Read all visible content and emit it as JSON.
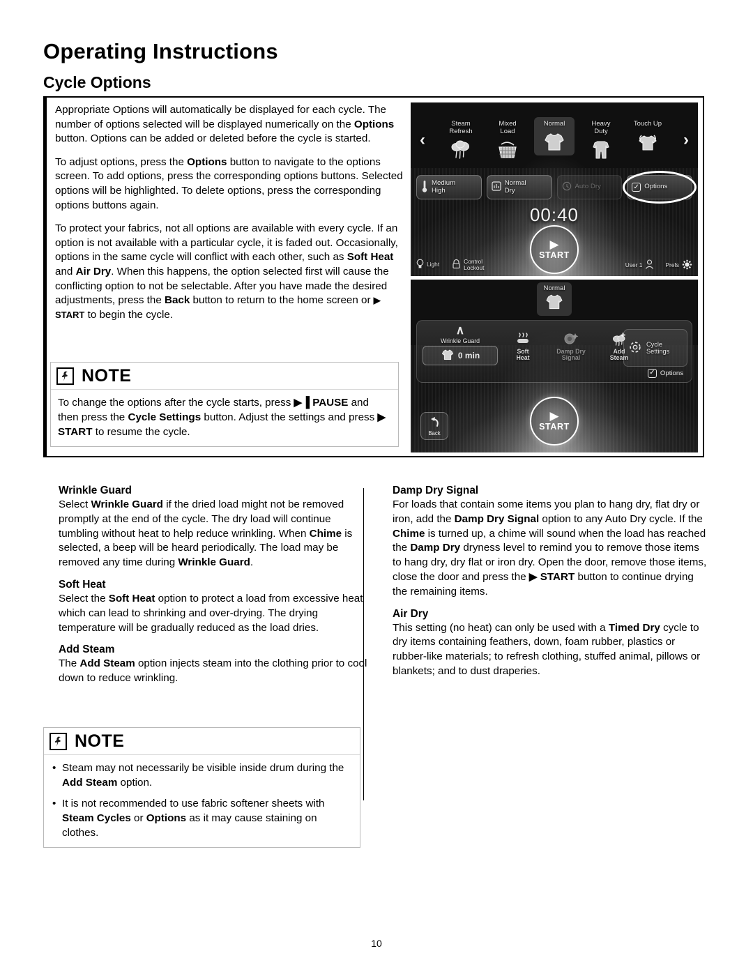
{
  "headings": {
    "h1": "Operating Instructions",
    "h2": "Cycle Options"
  },
  "intro": {
    "p1_a": "Appropriate Options will automatically be displayed for each cycle. The number of options selected will be displayed numerically on the ",
    "p1_b": "Options",
    "p1_c": " button. Options can be added or deleted before the cycle is started.",
    "p2_a": "To adjust options, press the ",
    "p2_b": "Options",
    "p2_c": " button to navigate to the options screen. To add options, press the corresponding options buttons. Selected options will be highlighted. To delete options, press the corresponding options buttons again.",
    "p3_a": "To protect your fabrics, not all options are available with every cycle. If an option is not available with a particular cycle, it is faded out. Occasionally, options in the same cycle will conflict with each other, such as ",
    "p3_b": "Soft Heat",
    "p3_c": " and ",
    "p3_d": "Air Dry",
    "p3_e": ". When this happens, the option selected first will cause the conflicting option to not be selectable. After you have made the desired adjustments, press the ",
    "p3_f": "Back",
    "p3_g": " button to return to the home screen or ",
    "p3_h": "▶ START",
    "p3_i": " to begin the cycle."
  },
  "note1": {
    "title": "NOTE",
    "icon": "pushpin-icon",
    "a": "To change the options after the cycle starts, press ",
    "b": "▶▐ PAUSE",
    "c": " and then press the ",
    "d": "Cycle Settings",
    "e": " button. Adjust the settings and press ",
    "f": "▶ START",
    "g": " to resume the cycle."
  },
  "panel1": {
    "prev_arrow": "‹",
    "next_arrow": "›",
    "cycles": [
      {
        "label": "Steam\nRefresh",
        "icon": "steam-cloud-icon",
        "selected": false
      },
      {
        "label": "Mixed\nLoad",
        "icon": "laundry-basket-icon",
        "selected": false
      },
      {
        "label": "Normal",
        "icon": "tshirt-icon",
        "selected": true
      },
      {
        "label": "Heavy\nDuty",
        "icon": "coveralls-icon",
        "selected": false
      },
      {
        "label": "Touch Up",
        "icon": "tshirt-refresh-icon",
        "selected": false
      }
    ],
    "options": [
      {
        "label": "Medium\nHigh",
        "icon": "thermometer-icon",
        "faded": false,
        "highlighted": false
      },
      {
        "label": "Normal\nDry",
        "icon": "dryness-icon",
        "faded": false,
        "highlighted": false
      },
      {
        "label": "Auto Dry",
        "icon": "clock-icon",
        "faded": true,
        "highlighted": false
      },
      {
        "label": "Options",
        "icon": "checkbox-icon",
        "faded": false,
        "highlighted": true
      }
    ],
    "timer": "00:40",
    "start_label": "START",
    "start_triangle": "▶",
    "bottom_left": [
      {
        "label": "Light",
        "icon": "bulb-icon"
      },
      {
        "label": "Control\nLockout",
        "icon": "lock-icon"
      }
    ],
    "bottom_right": [
      {
        "label": "User 1",
        "icon": "user-icon"
      },
      {
        "label": "Prefs",
        "icon": "gear-icon"
      }
    ]
  },
  "panel2": {
    "selected_cycle": "Normal",
    "selected_cycle_icon": "tshirt-icon",
    "wrinkle_guard": {
      "chevron": "∧",
      "label": "Wrinkle Guard",
      "value": "0 min",
      "icon": "tshirt-icon"
    },
    "options": [
      {
        "label": "Soft\nHeat",
        "icon": "soft-heat-icon",
        "faded": false
      },
      {
        "label": "Damp Dry\nSignal",
        "icon": "damp-dry-signal-icon",
        "faded": true
      },
      {
        "label": "Add\nSteam",
        "icon": "add-steam-icon",
        "faded": false
      }
    ],
    "cycle_settings": {
      "label": "Cycle\nSettings",
      "icon": "cycle-settings-icon"
    },
    "options_checkbox": {
      "label": "Options",
      "check": "✓"
    },
    "back_button": {
      "label": "Back",
      "icon": "back-arrow-icon"
    },
    "start_label": "START",
    "start_triangle": "▶"
  },
  "sections_left": [
    {
      "heading": "Wrinkle Guard",
      "parts": [
        {
          "t": "Select ",
          "b": false
        },
        {
          "t": "Wrinkle Guard",
          "b": true
        },
        {
          "t": " if the dried load might not be removed promptly at the end of the cycle. The dry load will continue tumbling without heat to help reduce wrinkling. When ",
          "b": false
        },
        {
          "t": "Chime",
          "b": true
        },
        {
          "t": " is selected, a beep will be heard periodically. The load may be removed any time during ",
          "b": false
        },
        {
          "t": "Wrinkle Guard",
          "b": true
        },
        {
          "t": ".",
          "b": false
        }
      ]
    },
    {
      "heading": "Soft Heat",
      "parts": [
        {
          "t": "Select the ",
          "b": false
        },
        {
          "t": "Soft Heat",
          "b": true
        },
        {
          "t": " option to protect a load from excessive heat which can lead to shrinking and over-drying. The drying temperature will be gradually reduced as the load dries.",
          "b": false
        }
      ]
    },
    {
      "heading": "Add Steam",
      "parts": [
        {
          "t": "The ",
          "b": false
        },
        {
          "t": "Add Steam",
          "b": true
        },
        {
          "t": " option injects steam into the clothing prior to cool down to reduce wrinkling.",
          "b": false
        }
      ]
    }
  ],
  "sections_right": [
    {
      "heading": "Damp Dry Signal",
      "parts": [
        {
          "t": "For loads that contain some items you plan to hang dry, flat dry or iron, add the ",
          "b": false
        },
        {
          "t": "Damp Dry Signal",
          "b": true
        },
        {
          "t": " option to any Auto Dry cycle. If the ",
          "b": false
        },
        {
          "t": "Chime",
          "b": true
        },
        {
          "t": " is turned up, a chime will sound when the load has reached the ",
          "b": false
        },
        {
          "t": "Damp Dry",
          "b": true
        },
        {
          "t": " dryness level to remind you to remove those items to hang dry, dry flat or iron dry. Open the door, remove those items, close the door and press the ",
          "b": false
        },
        {
          "t": "▶ START",
          "b": true
        },
        {
          "t": " button to continue drying the remaining items.",
          "b": false
        }
      ]
    },
    {
      "heading": "Air Dry",
      "parts": [
        {
          "t": "This setting (no heat) can only be used with a ",
          "b": false
        },
        {
          "t": "Timed Dry",
          "b": true
        },
        {
          "t": " cycle to dry items containing feathers, down, foam rubber, plastics or rubber-like materials; to refresh clothing, stuffed animal, pillows or blankets; and to dust draperies.",
          "b": false
        }
      ]
    }
  ],
  "note2": {
    "title": "NOTE",
    "icon": "pushpin-icon",
    "bullets": [
      [
        {
          "t": "Steam may not necessarily be visible inside drum during the ",
          "b": false
        },
        {
          "t": "Add Steam",
          "b": true
        },
        {
          "t": " option.",
          "b": false
        }
      ],
      [
        {
          "t": "It is not recommended to use fabric softener sheets with ",
          "b": false
        },
        {
          "t": "Steam Cycles",
          "b": true
        },
        {
          "t": " or ",
          "b": false
        },
        {
          "t": "Options",
          "b": true
        },
        {
          "t": " as it may cause staining on clothes.",
          "b": false
        }
      ]
    ]
  },
  "page_number": "10"
}
